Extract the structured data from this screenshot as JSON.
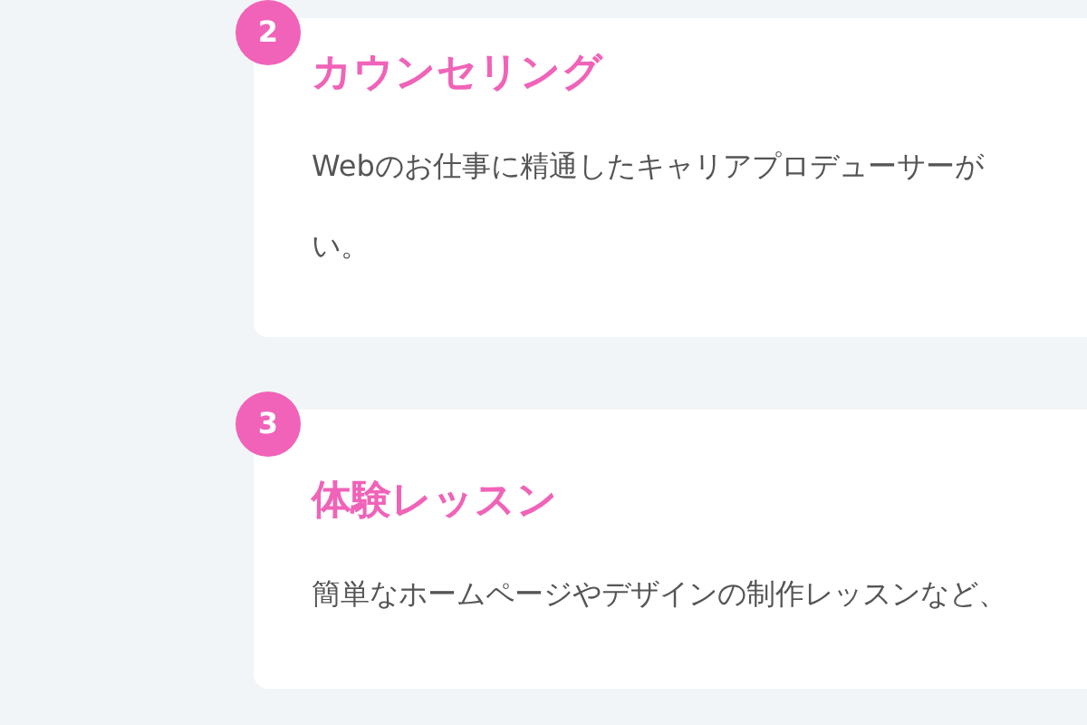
{
  "steps": [
    {
      "number": "2",
      "title": "カウンセリング",
      "lines": [
        "Webのお仕事に精通したキャリアプロデューサーが",
        "い。"
      ]
    },
    {
      "number": "3",
      "title": "体験レッスン",
      "lines": [
        "簡単なホームページやデザインの制作レッスンなど、"
      ]
    }
  ]
}
